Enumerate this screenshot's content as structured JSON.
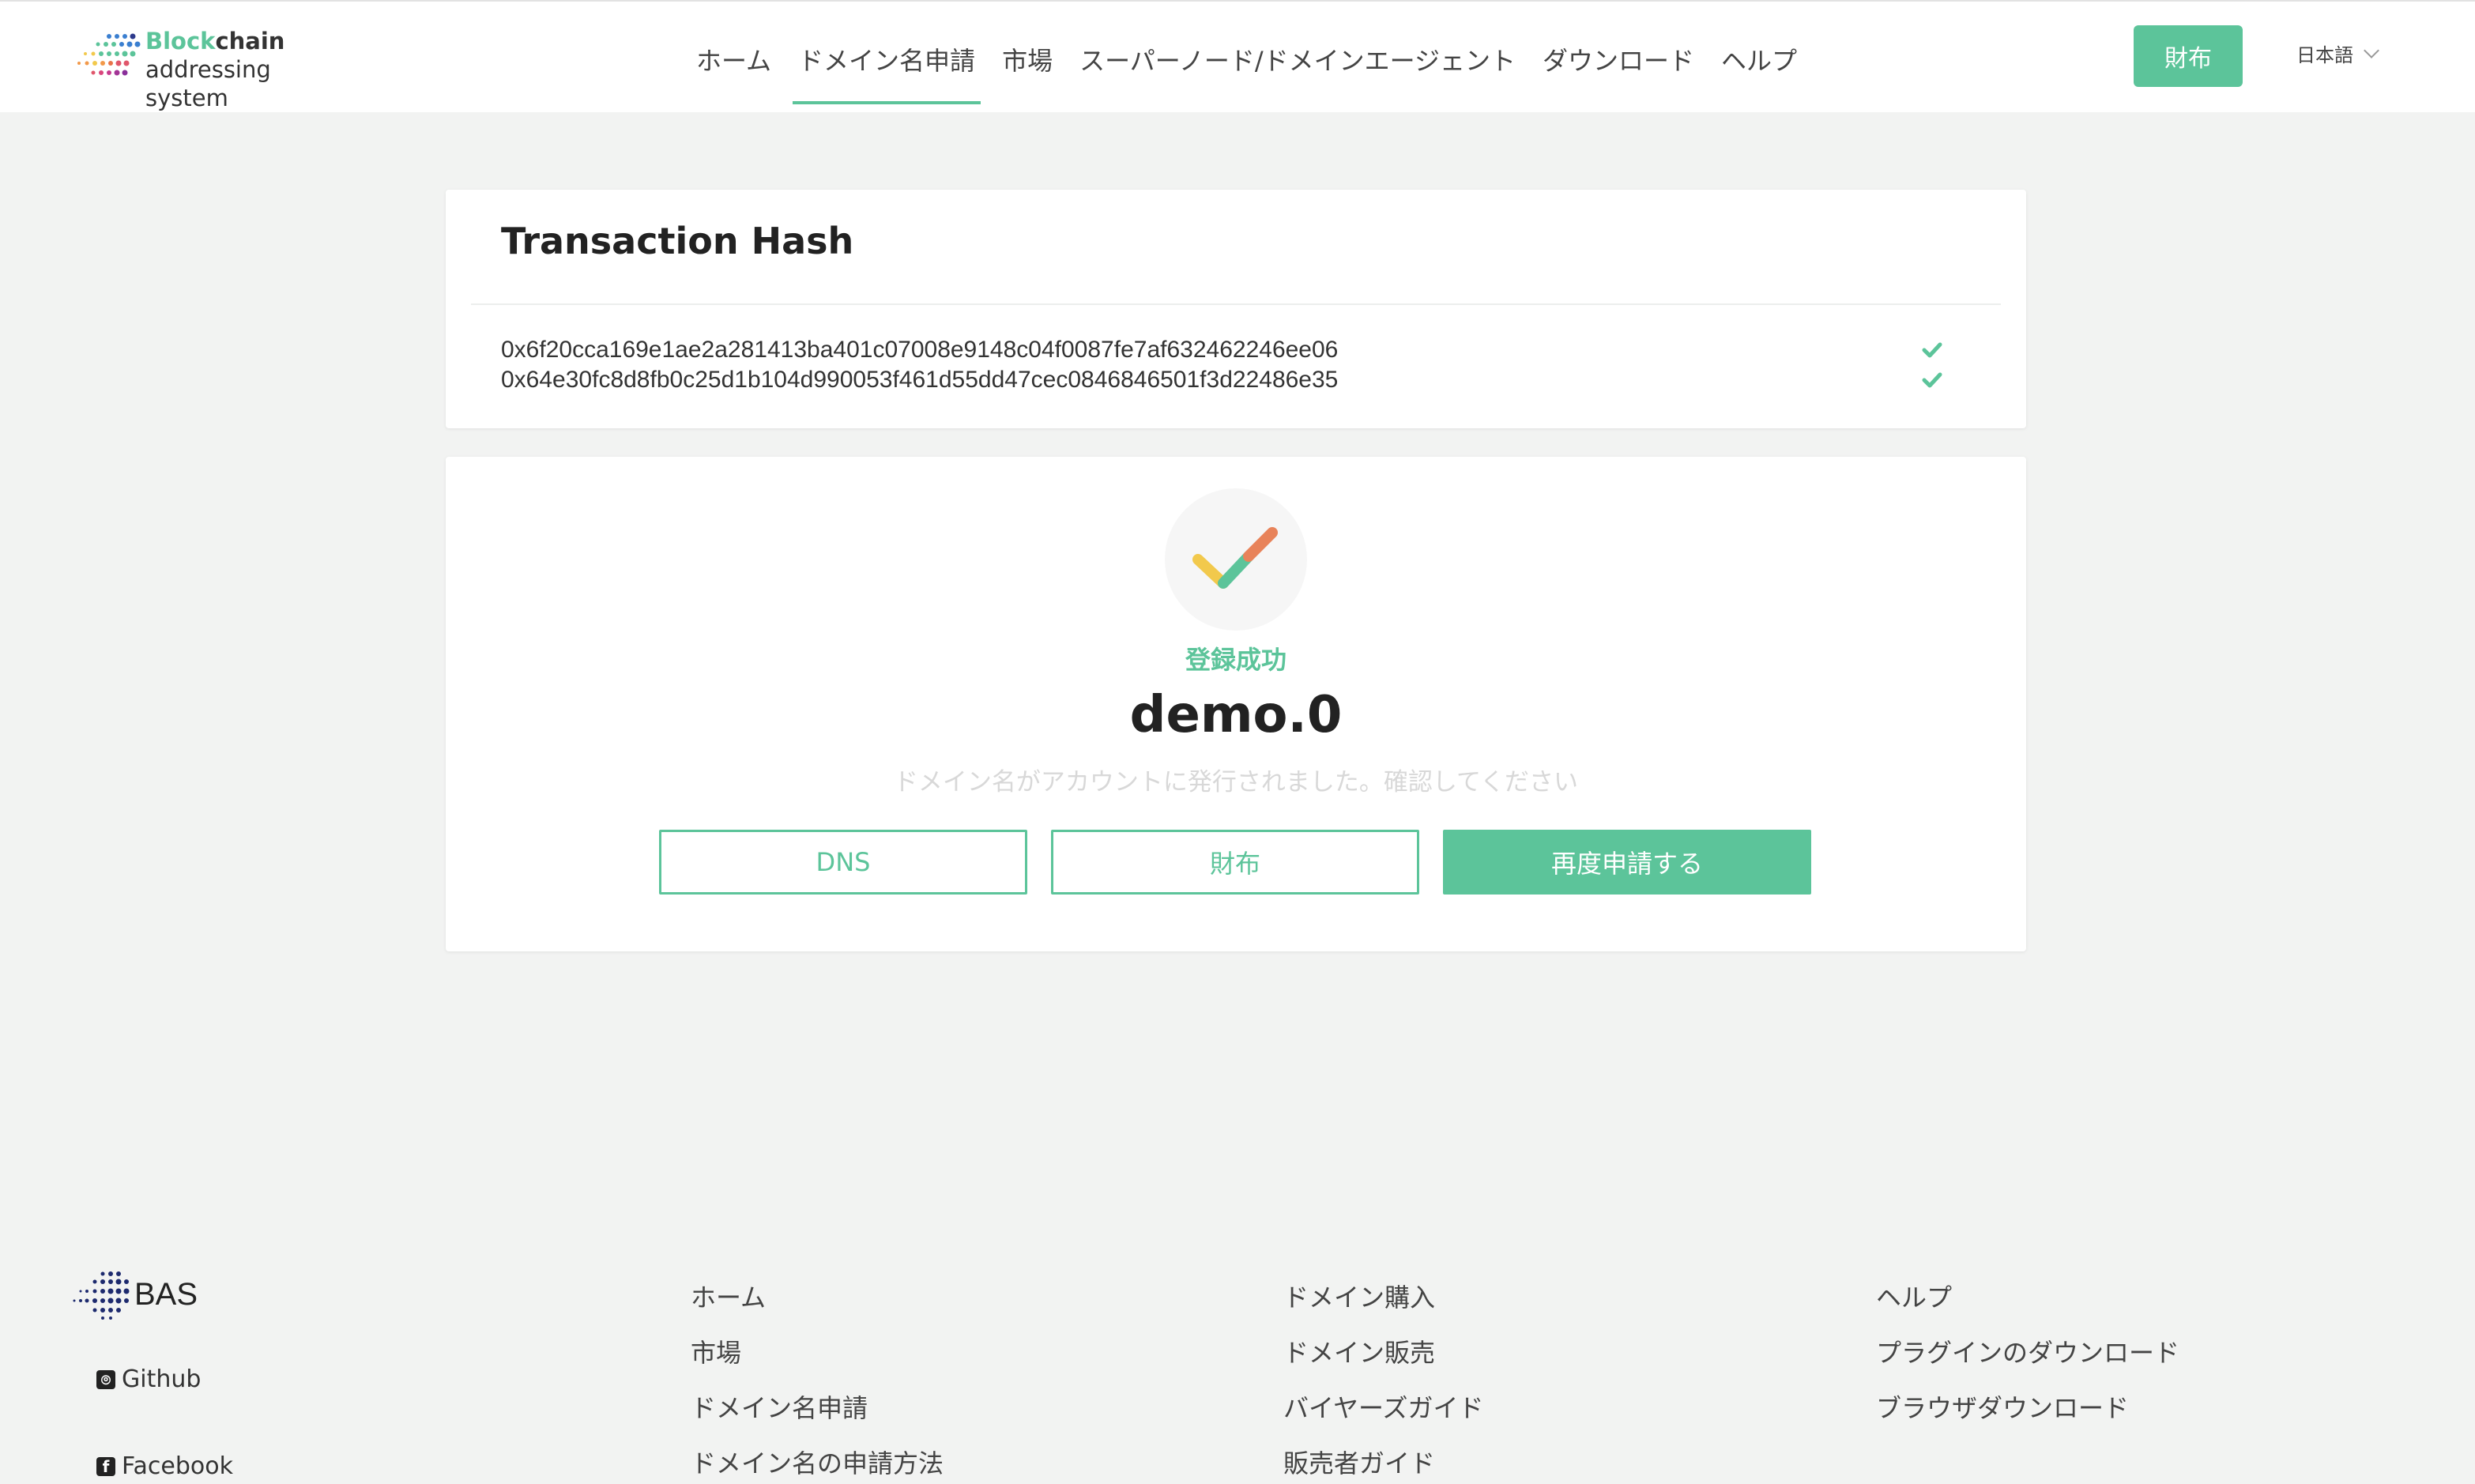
{
  "header": {
    "logo_word1": "Block",
    "logo_word1b": "chain",
    "logo_line2": "addressing system",
    "nav": [
      {
        "label": "ホーム",
        "active": false
      },
      {
        "label": "ドメイン名申請",
        "active": true
      },
      {
        "label": "市場",
        "active": false
      },
      {
        "label": "スーパーノード/ドメインエージェント",
        "active": false
      },
      {
        "label": "ダウンロード",
        "active": false
      },
      {
        "label": "ヘルプ",
        "active": false
      }
    ],
    "wallet_button": "財布",
    "language": "日本語"
  },
  "transaction": {
    "title": "Transaction Hash",
    "hashes": [
      "0x6f20cca169e1ae2a281413ba401c07008e9148c04f0087fe7af632462246ee06",
      "0x64e30fc8d8fb0c25d1b104d990053f461d55dd47cec0846846501f3d22486e35"
    ]
  },
  "result": {
    "status": "登録成功",
    "domain": "demo.0",
    "message": "ドメイン名がアカウントに発行されました。確認してください",
    "buttons": {
      "dns": "DNS",
      "wallet": "財布",
      "apply_again": "再度申請する"
    }
  },
  "footer": {
    "brand": "BAS",
    "social": [
      {
        "label": "Github",
        "icon": "github-icon"
      },
      {
        "label": "Facebook",
        "icon": "facebook-icon"
      }
    ],
    "columns": [
      [
        "ホーム",
        "市場",
        "ドメイン名申請",
        "ドメイン名の申請方法"
      ],
      [
        "ドメイン購入",
        "ドメイン販売",
        "バイヤーズガイド",
        "販売者ガイド"
      ],
      [
        "ヘルプ",
        "プラグインのダウンロード",
        "ブラウザダウンロード"
      ]
    ]
  },
  "colors": {
    "accent": "#5cc49a",
    "background": "#f2f3f2"
  }
}
